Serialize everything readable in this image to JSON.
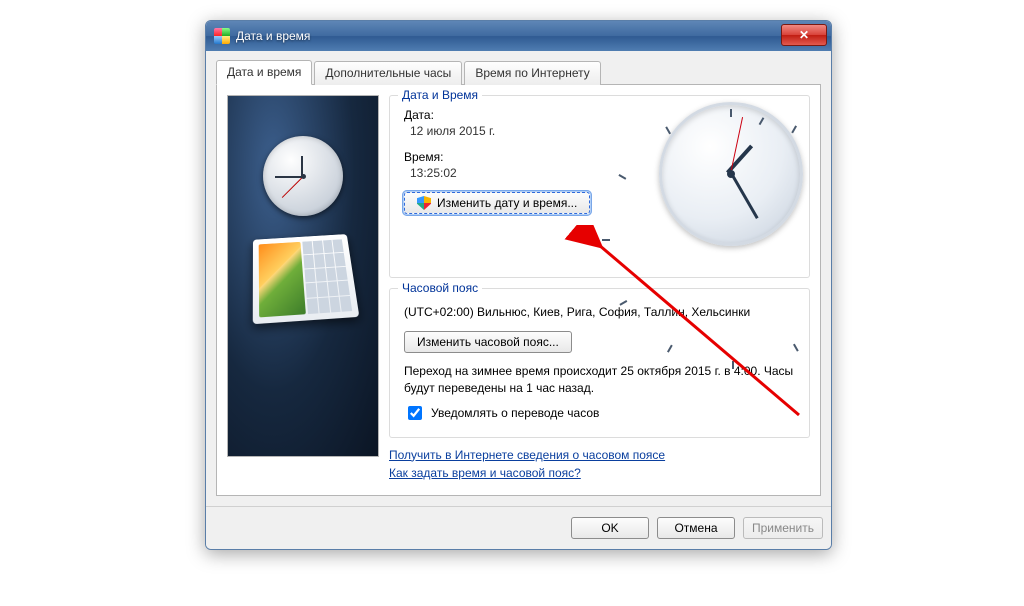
{
  "window": {
    "title": "Дата и время"
  },
  "tabs": {
    "t0": "Дата и время",
    "t1": "Дополнительные часы",
    "t2": "Время по Интернету"
  },
  "datetime_group": {
    "title": "Дата и Время",
    "date_label": "Дата:",
    "date_value": "12 июля 2015 г.",
    "time_label": "Время:",
    "time_value": "13:25:02",
    "change_btn": "Изменить дату и время..."
  },
  "tz_group": {
    "title": "Часовой пояс",
    "tz_value": "(UTC+02:00) Вильнюс, Киев, Рига, София, Таллин, Хельсинки",
    "change_btn": "Изменить часовой пояс...",
    "dst_note": "Переход на зимнее время происходит 25 октября 2015 г. в 4:00. Часы будут переведены на 1 час назад.",
    "notify_label": "Уведомлять о переводе часов",
    "notify_checked": true
  },
  "links": {
    "l1": "Получить в Интернете сведения о часовом поясе",
    "l2": "Как задать время и часовой пояс?"
  },
  "footer": {
    "ok": "OK",
    "cancel": "Отмена",
    "apply": "Применить"
  }
}
